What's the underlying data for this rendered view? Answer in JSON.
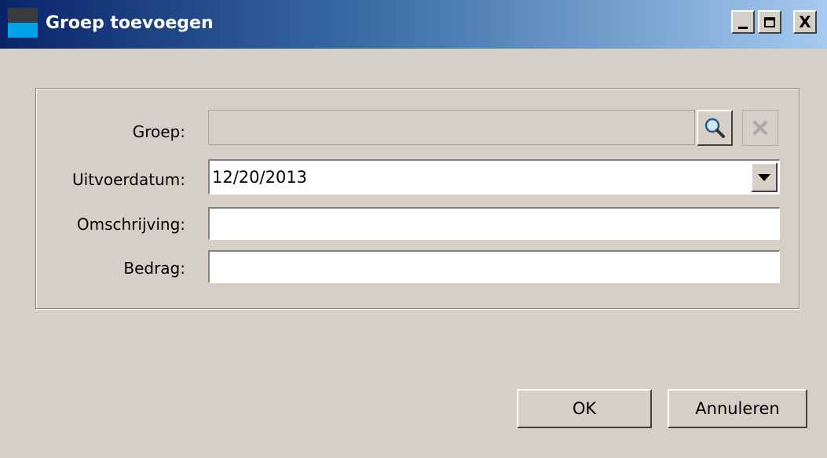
{
  "window": {
    "title": "Groep toevoegen",
    "controls": {
      "minimize": "_",
      "maximize": "□",
      "close": "X"
    }
  },
  "form": {
    "groep": {
      "label": "Groep:",
      "value": ""
    },
    "uitvoerdatum": {
      "label": "Uitvoerdatum:",
      "value": "12/20/2013"
    },
    "omschrijving": {
      "label": "Omschrijving:",
      "value": ""
    },
    "bedrag": {
      "label": "Bedrag:",
      "value": ""
    }
  },
  "icons": {
    "lookup": "search-icon",
    "clear": "clear-icon",
    "dropdown": "chevron-down-icon"
  },
  "buttons": {
    "ok": "OK",
    "cancel": "Annuleren"
  },
  "colors": {
    "title_start": "#0a246a",
    "title_end": "#a6caf0",
    "background": "#d4d0c8"
  }
}
